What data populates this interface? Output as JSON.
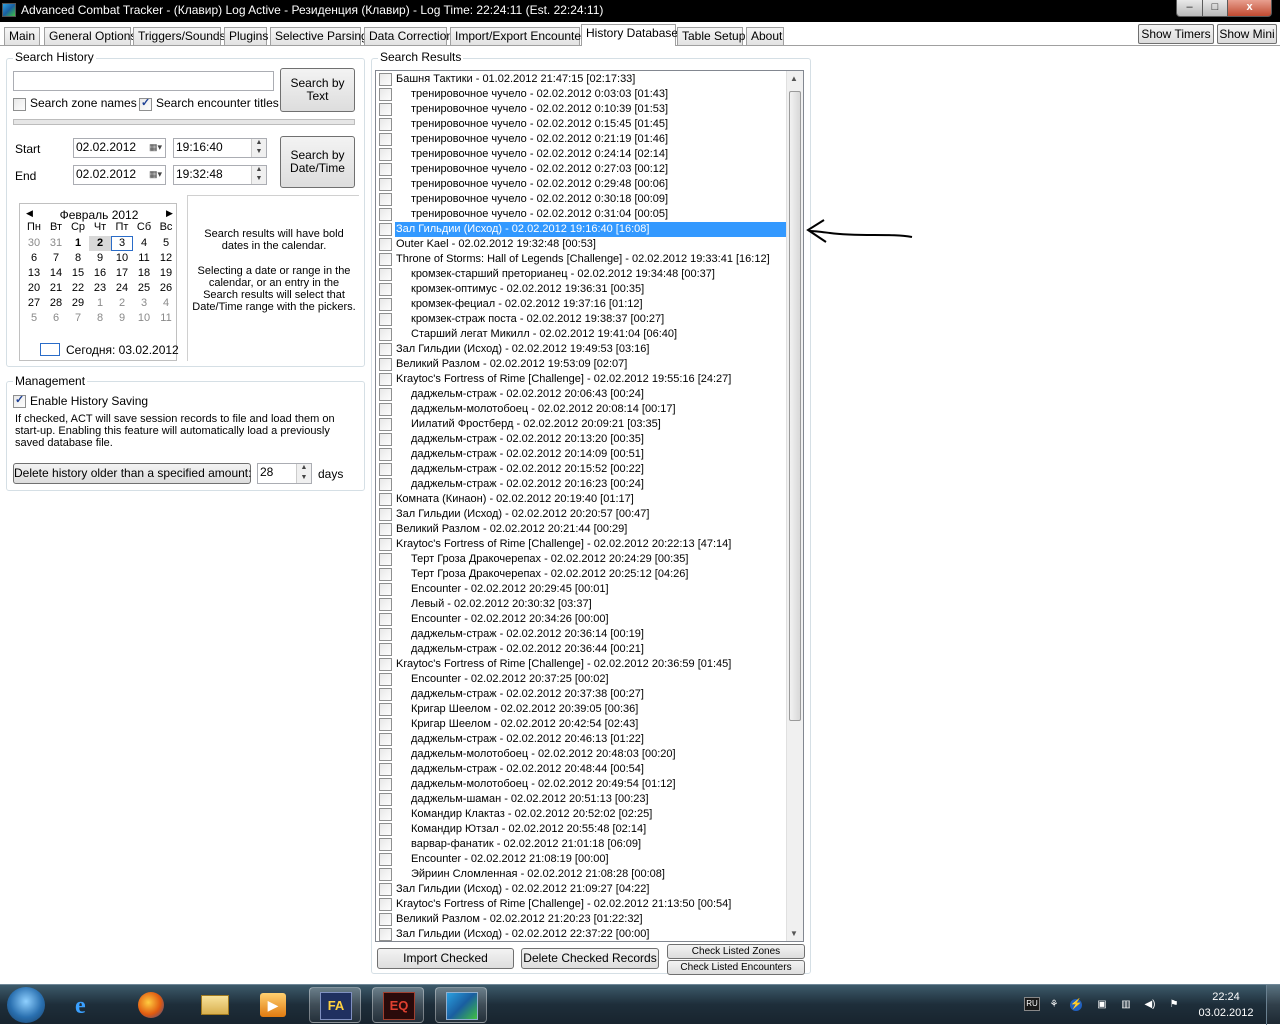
{
  "window": {
    "title": "Advanced Combat Tracker - (Клавир) Log Active - Резиденция (Клавир) - Log Time: 22:24:11 (Est. 22:24:11)",
    "minimize_glyph": "–",
    "maximize_glyph": "□",
    "close_glyph": "x"
  },
  "tabs": [
    {
      "label": "Main"
    },
    {
      "label": "General Options"
    },
    {
      "label": "Triggers/Sounds"
    },
    {
      "label": "Plugins"
    },
    {
      "label": "Selective Parsing"
    },
    {
      "label": "Data Correction"
    },
    {
      "label": "Import/Export Encounters"
    },
    {
      "label": "History Database",
      "active": true
    },
    {
      "label": "Table Setup"
    },
    {
      "label": "About"
    }
  ],
  "header_buttons": {
    "show_timers": "Show Timers",
    "show_mini": "Show Mini"
  },
  "search_history": {
    "title": "Search History",
    "search_text_value": "",
    "search_by_text_label": "Search by\nText",
    "zone_names_label": "Search zone names",
    "zone_names_checked": false,
    "encounter_titles_label": "Search encounter titles",
    "encounter_titles_checked": true,
    "start_label": "Start",
    "start_date": "02.02.2012",
    "start_time": "19:16:40",
    "end_label": "End",
    "end_date": "02.02.2012",
    "end_time": "19:32:48",
    "search_by_datetime_label": "Search by\nDate/Time",
    "info_text_1": "Search results will have bold dates in the calendar.",
    "info_text_2": "Selecting a date or range in the calendar, or an entry in the Search results will select that Date/Time range with the pickers."
  },
  "calendar": {
    "month_label": "Февраль 2012",
    "weekdays": [
      "Пн",
      "Вт",
      "Ср",
      "Чт",
      "Пт",
      "Сб",
      "Вс"
    ],
    "weeks": [
      [
        "30",
        "31",
        "1",
        "2",
        "3",
        "4",
        "5"
      ],
      [
        "6",
        "7",
        "8",
        "9",
        "10",
        "11",
        "12"
      ],
      [
        "13",
        "14",
        "15",
        "16",
        "17",
        "18",
        "19"
      ],
      [
        "20",
        "21",
        "22",
        "23",
        "24",
        "25",
        "26"
      ],
      [
        "27",
        "28",
        "29",
        "1",
        "2",
        "3",
        "4"
      ],
      [
        "5",
        "6",
        "7",
        "8",
        "9",
        "10",
        "11"
      ]
    ],
    "bold_days": [
      "1",
      "2"
    ],
    "selected_day": "2",
    "today_day": "3",
    "today_label": "Сегодня: 03.02.2012"
  },
  "management": {
    "title": "Management",
    "enable_saving_label": "Enable History Saving",
    "enable_saving_checked": true,
    "description": "If checked, ACT will save session records to file and load them on start-up.  Enabling this feature will automatically load a previously saved database file.",
    "delete_button": "Delete history older than a specified amount:",
    "days_value": "28",
    "days_label": "days"
  },
  "results": {
    "title": "Search Results",
    "selected_index": 10,
    "items": [
      {
        "text": "Башня Тактики - 01.02.2012 21:47:15 [02:17:33]",
        "indent": 0
      },
      {
        "text": "тренировочное чучело - 02.02.2012 0:03:03 [01:43]",
        "indent": 1
      },
      {
        "text": "тренировочное чучело - 02.02.2012 0:10:39 [01:53]",
        "indent": 1
      },
      {
        "text": "тренировочное чучело - 02.02.2012 0:15:45 [01:45]",
        "indent": 1
      },
      {
        "text": "тренировочное чучело - 02.02.2012 0:21:19 [01:46]",
        "indent": 1
      },
      {
        "text": "тренировочное чучело - 02.02.2012 0:24:14 [02:14]",
        "indent": 1
      },
      {
        "text": "тренировочное чучело - 02.02.2012 0:27:03 [00:12]",
        "indent": 1
      },
      {
        "text": "тренировочное чучело - 02.02.2012 0:29:48 [00:06]",
        "indent": 1
      },
      {
        "text": "тренировочное чучело - 02.02.2012 0:30:18 [00:09]",
        "indent": 1
      },
      {
        "text": "тренировочное чучело - 02.02.2012 0:31:04 [00:05]",
        "indent": 1
      },
      {
        "text": "Зал Гильдии (Исход) - 02.02.2012 19:16:40 [16:08]",
        "indent": 0
      },
      {
        "text": "Outer Kael - 02.02.2012 19:32:48 [00:53]",
        "indent": 0
      },
      {
        "text": "Throne of Storms: Hall of Legends [Challenge] - 02.02.2012 19:33:41 [16:12]",
        "indent": 0
      },
      {
        "text": "кромзек-старший преторианец - 02.02.2012 19:34:48 [00:37]",
        "indent": 1
      },
      {
        "text": "кромзек-оптимус - 02.02.2012 19:36:31 [00:35]",
        "indent": 1
      },
      {
        "text": "кромзек-фециал - 02.02.2012 19:37:16 [01:12]",
        "indent": 1
      },
      {
        "text": "кромзек-страж поста - 02.02.2012 19:38:37 [00:27]",
        "indent": 1
      },
      {
        "text": "Старший легат Микилл - 02.02.2012 19:41:04 [06:40]",
        "indent": 1
      },
      {
        "text": "Зал Гильдии (Исход) - 02.02.2012 19:49:53 [03:16]",
        "indent": 0
      },
      {
        "text": "Великий Разлом - 02.02.2012 19:53:09 [02:07]",
        "indent": 0
      },
      {
        "text": "Kraytoc's Fortress of Rime [Challenge] - 02.02.2012 19:55:16 [24:27]",
        "indent": 0
      },
      {
        "text": "даджельм-страж - 02.02.2012 20:06:43 [00:24]",
        "indent": 1
      },
      {
        "text": "даджельм-молотобоец - 02.02.2012 20:08:14 [00:17]",
        "indent": 1
      },
      {
        "text": "Иилатий Фростберд - 02.02.2012 20:09:21 [03:35]",
        "indent": 1
      },
      {
        "text": "даджельм-страж - 02.02.2012 20:13:20 [00:35]",
        "indent": 1
      },
      {
        "text": "даджельм-страж - 02.02.2012 20:14:09 [00:51]",
        "indent": 1
      },
      {
        "text": "даджельм-страж - 02.02.2012 20:15:52 [00:22]",
        "indent": 1
      },
      {
        "text": "даджельм-страж - 02.02.2012 20:16:23 [00:24]",
        "indent": 1
      },
      {
        "text": "Комната (Кинаон) - 02.02.2012 20:19:40 [01:17]",
        "indent": 0
      },
      {
        "text": "Зал Гильдии (Исход) - 02.02.2012 20:20:57 [00:47]",
        "indent": 0
      },
      {
        "text": "Великий Разлом - 02.02.2012 20:21:44 [00:29]",
        "indent": 0
      },
      {
        "text": "Kraytoc's Fortress of Rime [Challenge] - 02.02.2012 20:22:13 [47:14]",
        "indent": 0
      },
      {
        "text": "Терт Гроза Дракочерепах - 02.02.2012 20:24:29 [00:35]",
        "indent": 1
      },
      {
        "text": "Терт Гроза Дракочерепах - 02.02.2012 20:25:12 [04:26]",
        "indent": 1
      },
      {
        "text": "Encounter - 02.02.2012 20:29:45 [00:01]",
        "indent": 1
      },
      {
        "text": "Левый - 02.02.2012 20:30:32 [03:37]",
        "indent": 1
      },
      {
        "text": "Encounter - 02.02.2012 20:34:26 [00:00]",
        "indent": 1
      },
      {
        "text": "даджельм-страж - 02.02.2012 20:36:14 [00:19]",
        "indent": 1
      },
      {
        "text": "даджельм-страж - 02.02.2012 20:36:44 [00:21]",
        "indent": 1
      },
      {
        "text": "Kraytoc's Fortress of Rime [Challenge] - 02.02.2012 20:36:59 [01:45]",
        "indent": 0
      },
      {
        "text": "Encounter - 02.02.2012 20:37:25 [00:02]",
        "indent": 1
      },
      {
        "text": "даджельм-страж - 02.02.2012 20:37:38 [00:27]",
        "indent": 1
      },
      {
        "text": "Кригар Шеелом - 02.02.2012 20:39:05 [00:36]",
        "indent": 1
      },
      {
        "text": "Кригар Шеелом - 02.02.2012 20:42:54 [02:43]",
        "indent": 1
      },
      {
        "text": "даджельм-страж - 02.02.2012 20:46:13 [01:22]",
        "indent": 1
      },
      {
        "text": "даджельм-молотобоец - 02.02.2012 20:48:03 [00:20]",
        "indent": 1
      },
      {
        "text": "даджельм-страж - 02.02.2012 20:48:44 [00:54]",
        "indent": 1
      },
      {
        "text": "даджельм-молотобоец - 02.02.2012 20:49:54 [01:12]",
        "indent": 1
      },
      {
        "text": "даджельм-шаман - 02.02.2012 20:51:13 [00:23]",
        "indent": 1
      },
      {
        "text": "Командир Клактаз - 02.02.2012 20:52:02 [02:25]",
        "indent": 1
      },
      {
        "text": "Командир Ютзал - 02.02.2012 20:55:48 [02:14]",
        "indent": 1
      },
      {
        "text": "варвар-фанатик - 02.02.2012 21:01:18 [06:09]",
        "indent": 1
      },
      {
        "text": "Encounter - 02.02.2012 21:08:19 [00:00]",
        "indent": 1
      },
      {
        "text": "Эйриин Сломленная - 02.02.2012 21:08:28 [00:08]",
        "indent": 1
      },
      {
        "text": "Зал Гильдии (Исход) - 02.02.2012 21:09:27 [04:22]",
        "indent": 0
      },
      {
        "text": "Kraytoc's Fortress of Rime [Challenge] - 02.02.2012 21:13:50 [00:54]",
        "indent": 0
      },
      {
        "text": "Великий Разлом - 02.02.2012 21:20:23 [01:22:32]",
        "indent": 0
      },
      {
        "text": "Зал Гильдии (Исход) - 02.02.2012 22:37:22 [00:00]",
        "indent": 0
      }
    ],
    "import_checked": "Import Checked",
    "delete_checked": "Delete Checked Records",
    "check_zones": "Check Listed Zones",
    "check_encounters": "Check Listed Encounters"
  },
  "taskbar": {
    "apps": [
      "windows-start",
      "internet-explorer",
      "firefox",
      "windows-explorer",
      "media-player",
      "fallout",
      "everquest2",
      "act"
    ],
    "clock_time": "22:24",
    "clock_date": "03.02.2012",
    "tray_lang": "RU"
  }
}
